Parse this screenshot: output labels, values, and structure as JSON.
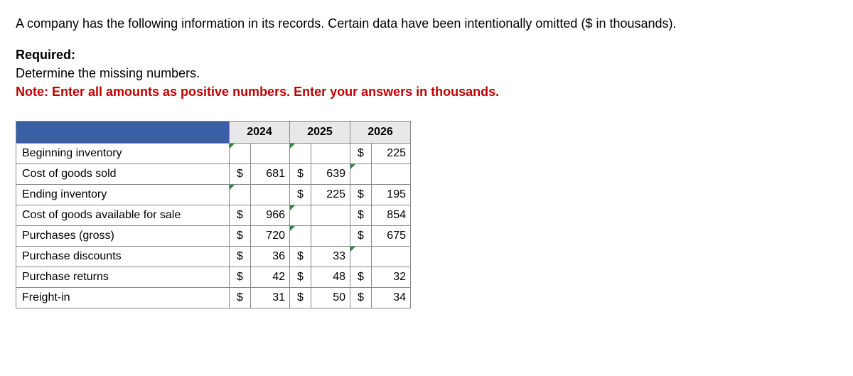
{
  "intro": "A company has the following information in its records. Certain data have been intentionally omitted ($ in thousands).",
  "required": {
    "title": "Required:",
    "line": "Determine the missing numbers.",
    "note": "Note: Enter all amounts as positive numbers. Enter your answers in thousands."
  },
  "years": {
    "y1": "2024",
    "y2": "2025",
    "y3": "2026"
  },
  "currency": "$",
  "rows": {
    "beg_inv": {
      "label": "Beginning inventory",
      "y1": {
        "sym": "",
        "val": "",
        "marker": true,
        "blank": true
      },
      "y2": {
        "sym": "",
        "val": "",
        "marker": true,
        "blank": true
      },
      "y3": {
        "sym": "$",
        "val": "225"
      }
    },
    "cogs": {
      "label": "Cost of goods sold",
      "y1": {
        "sym": "$",
        "val": "681"
      },
      "y2": {
        "sym": "$",
        "val": "639"
      },
      "y3": {
        "sym": "",
        "val": "",
        "marker": true,
        "blank": true
      }
    },
    "end_inv": {
      "label": "Ending inventory",
      "y1": {
        "sym": "",
        "val": "",
        "marker": true,
        "blank": true
      },
      "y2": {
        "sym": "$",
        "val": "225"
      },
      "y3": {
        "sym": "$",
        "val": "195"
      }
    },
    "cogas": {
      "label": "Cost of goods available for sale",
      "y1": {
        "sym": "$",
        "val": "966"
      },
      "y2": {
        "sym": "",
        "val": "",
        "marker": true,
        "blank": true
      },
      "y3": {
        "sym": "$",
        "val": "854"
      }
    },
    "purch": {
      "label": "Purchases (gross)",
      "y1": {
        "sym": "$",
        "val": "720"
      },
      "y2": {
        "sym": "",
        "val": "",
        "marker": true,
        "blank": true
      },
      "y3": {
        "sym": "$",
        "val": "675"
      }
    },
    "disc": {
      "label": "Purchase discounts",
      "y1": {
        "sym": "$",
        "val": "36"
      },
      "y2": {
        "sym": "$",
        "val": "33"
      },
      "y3": {
        "sym": "",
        "val": "",
        "marker": true,
        "blank": true
      }
    },
    "returns": {
      "label": "Purchase returns",
      "y1": {
        "sym": "$",
        "val": "42"
      },
      "y2": {
        "sym": "$",
        "val": "48"
      },
      "y3": {
        "sym": "$",
        "val": "32"
      }
    },
    "freight": {
      "label": "Freight-in",
      "y1": {
        "sym": "$",
        "val": "31"
      },
      "y2": {
        "sym": "$",
        "val": "50"
      },
      "y3": {
        "sym": "$",
        "val": "34"
      }
    }
  }
}
